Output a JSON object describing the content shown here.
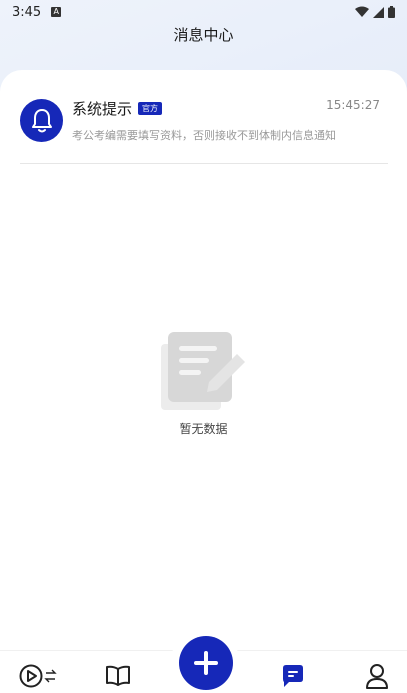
{
  "status_bar": {
    "time": "3:45",
    "notif_letter": "A"
  },
  "header": {
    "title": "消息中心"
  },
  "messages": [
    {
      "title": "系统提示",
      "badge": "官方",
      "time": "15:45:27",
      "content": "考公考编需要填写资料，否则接收不到体制内信息通知",
      "icon": "bell-icon"
    }
  ],
  "empty_state": {
    "text": "暂无数据",
    "icon": "document-edit-icon"
  },
  "tabbar": {
    "tabs": [
      {
        "icon": "play-switch-icon"
      },
      {
        "icon": "book-icon"
      },
      {
        "icon": "plus-icon"
      },
      {
        "icon": "message-icon",
        "active": true
      },
      {
        "icon": "user-icon"
      }
    ]
  },
  "colors": {
    "accent": "#1628b8",
    "background_top": "#eef3fb",
    "background_bottom": "#c6d6f2"
  }
}
